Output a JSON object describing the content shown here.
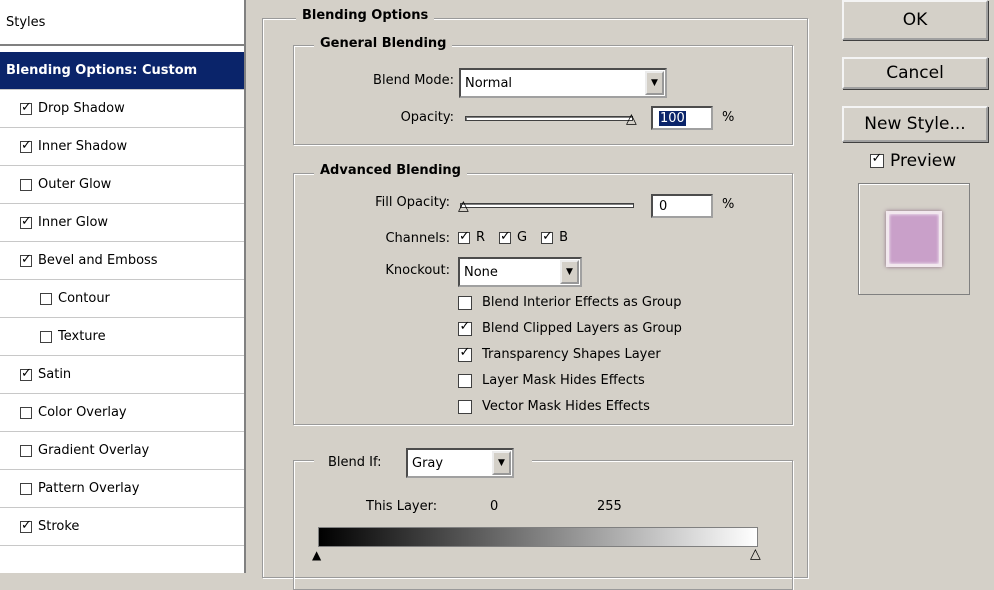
{
  "styles_panel": {
    "header": "Styles",
    "selected": "Blending Options: Custom",
    "items": [
      {
        "label": "Drop Shadow",
        "checked": true,
        "indent": false
      },
      {
        "label": "Inner Shadow",
        "checked": true,
        "indent": false
      },
      {
        "label": "Outer Glow",
        "checked": false,
        "indent": false
      },
      {
        "label": "Inner Glow",
        "checked": true,
        "indent": false
      },
      {
        "label": "Bevel and Emboss",
        "checked": true,
        "indent": false
      },
      {
        "label": "Contour",
        "checked": false,
        "indent": true
      },
      {
        "label": "Texture",
        "checked": false,
        "indent": true
      },
      {
        "label": "Satin",
        "checked": true,
        "indent": false
      },
      {
        "label": "Color Overlay",
        "checked": false,
        "indent": false
      },
      {
        "label": "Gradient Overlay",
        "checked": false,
        "indent": false
      },
      {
        "label": "Pattern Overlay",
        "checked": false,
        "indent": false
      },
      {
        "label": "Stroke",
        "checked": true,
        "indent": false
      }
    ]
  },
  "blending_options": {
    "title": "Blending Options",
    "general": {
      "title": "General Blending",
      "blend_mode_label": "Blend Mode:",
      "blend_mode_value": "Normal",
      "opacity_label": "Opacity:",
      "opacity_value": "100",
      "opacity_unit": "%",
      "opacity_fraction": 1.0
    },
    "advanced": {
      "title": "Advanced Blending",
      "fill_opacity_label": "Fill Opacity:",
      "fill_opacity_value": "0",
      "fill_opacity_unit": "%",
      "fill_opacity_fraction": 0.0,
      "channels_label": "Channels:",
      "channels": [
        {
          "label": "R",
          "checked": true
        },
        {
          "label": "G",
          "checked": true
        },
        {
          "label": "B",
          "checked": true
        }
      ],
      "knockout_label": "Knockout:",
      "knockout_value": "None",
      "options": [
        {
          "label": "Blend Interior Effects as Group",
          "checked": false
        },
        {
          "label": "Blend Clipped Layers as Group",
          "checked": true
        },
        {
          "label": "Transparency Shapes Layer",
          "checked": true
        },
        {
          "label": "Layer Mask Hides Effects",
          "checked": false
        },
        {
          "label": "Vector Mask Hides Effects",
          "checked": false
        }
      ]
    },
    "blend_if": {
      "label": "Blend If:",
      "value": "Gray",
      "this_layer_label": "This Layer:",
      "this_layer_low": "0",
      "this_layer_high": "255"
    }
  },
  "buttons": {
    "ok": "OK",
    "cancel": "Cancel",
    "new_style": "New Style...",
    "preview_label": "Preview",
    "preview_checked": true
  },
  "colors": {
    "selection": "#0a246a",
    "preview_swatch": "#c9a0c9"
  }
}
